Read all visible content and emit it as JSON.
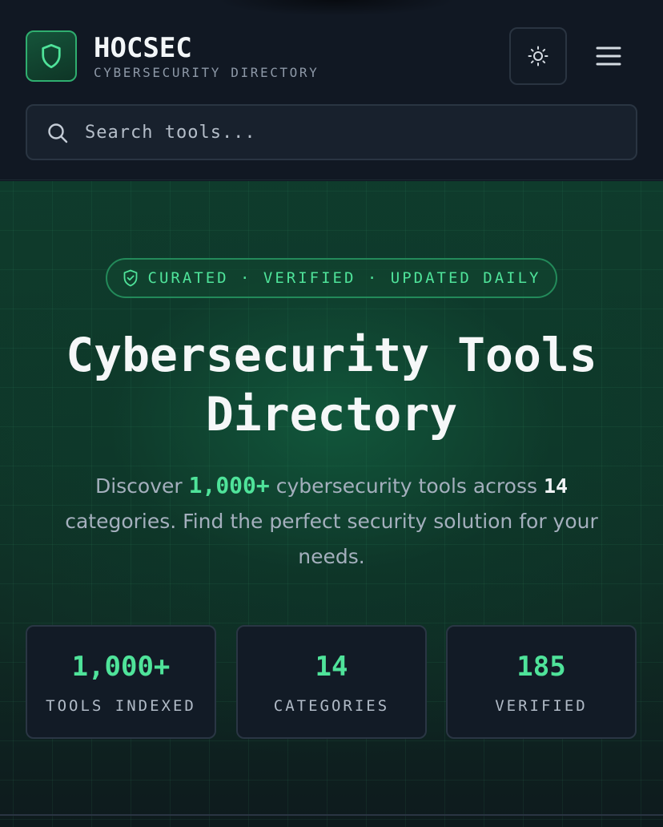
{
  "header": {
    "brand_title": "HOCSEC",
    "brand_subtitle": "CYBERSECURITY DIRECTORY",
    "logo_icon": "shield-icon",
    "theme_toggle_icon": "sun-icon",
    "menu_icon": "hamburger-menu-icon"
  },
  "search": {
    "placeholder": "Search tools...",
    "value": ""
  },
  "hero": {
    "badge_text": "CURATED · VERIFIED · UPDATED DAILY",
    "title_line1": "Cybersecurity Tools",
    "title_line2": "Directory",
    "desc_prefix": "Discover ",
    "desc_tools_count": "1,000+",
    "desc_middle": " cybersecurity tools across ",
    "desc_categories_count": "14",
    "desc_suffix": " categories. Find the perfect security solution for your needs."
  },
  "stats": [
    {
      "value": "1,000+",
      "label": "TOOLS INDEXED"
    },
    {
      "value": "14",
      "label": "CATEGORIES"
    },
    {
      "value": "185",
      "label": "VERIFIED"
    }
  ],
  "colors": {
    "accent": "#4fe39a",
    "background": "#0e1420",
    "panel": "#121b26",
    "border": "#2a3644"
  }
}
